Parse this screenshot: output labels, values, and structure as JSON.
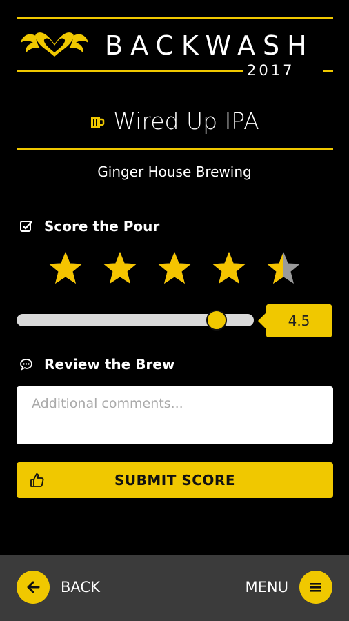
{
  "header": {
    "brand": "BACKWASH",
    "year": "2017",
    "logo_icon": "winged-heart-logo",
    "accent_color": "#f0c800"
  },
  "beer": {
    "name": "Wired Up IPA",
    "brewery": "Ginger House Brewing",
    "icon": "beer-mug-icon"
  },
  "score_section": {
    "heading": "Score the Pour",
    "icon": "checkbox-icon",
    "rating": 4.5,
    "max_rating": 5,
    "slider_value": "4.5"
  },
  "review_section": {
    "heading": "Review the Brew",
    "icon": "speech-bubble-icon",
    "placeholder": "Additional comments...",
    "value": ""
  },
  "submit": {
    "label": "SUBMIT SCORE",
    "icon": "thumbs-up-icon"
  },
  "bottom_nav": {
    "back_label": "BACK",
    "menu_label": "MENU"
  }
}
